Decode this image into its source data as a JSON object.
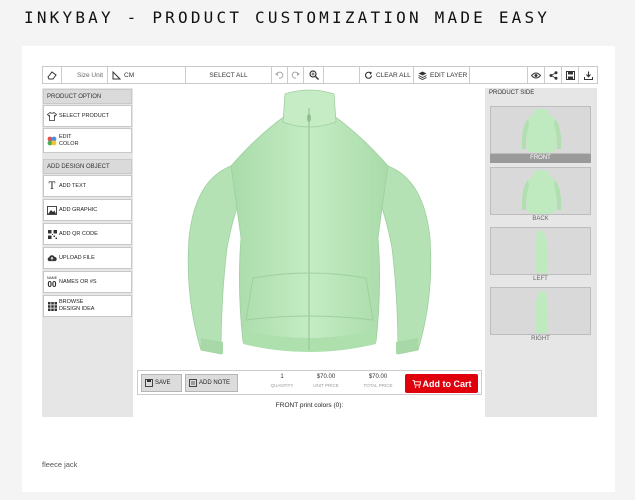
{
  "header": {
    "title": "INKYBAY - PRODUCT CUSTOMIZATION MADE EASY"
  },
  "toolbar": {
    "size_unit_label": "Size Unit",
    "unit_value": "CM",
    "select_all": "SELECT ALL",
    "clear_all": "CLEAR ALL",
    "edit_layer": "EDIT LAYER"
  },
  "sidebar": {
    "product_option_title": "PRODUCT OPTION",
    "select_product": "SELECT PRODUCT",
    "edit_color_1": "EDIT",
    "edit_color_2": "COLOR",
    "design_title": "ADD DESIGN OBJECT",
    "add_text": "ADD TEXT",
    "add_graphic": "ADD GRAPHIC",
    "add_qr": "ADD QR CODE",
    "upload_file": "UPLOAD FILE",
    "names_numbers": "NAMES OR #S",
    "browse_1": "BROWSE",
    "browse_2": "DESIGN IDEA"
  },
  "product_side": {
    "title": "PRODUCT SIDE",
    "sides": [
      "FRONT",
      "BACK",
      "LEFT",
      "RIGHT"
    ],
    "active": "FRONT"
  },
  "bottom": {
    "save": "SAVE",
    "add_note": "ADD NOTE",
    "quantity_value": "1",
    "quantity_label": "QUANTITY",
    "unit_price_value": "$70.00",
    "unit_price_label": "UNIT PRICE",
    "total_price_value": "$70.00",
    "total_price_label": "TOTAL PRICE",
    "add_to_cart": "Add to Cart"
  },
  "print_colors": "FRONT print colors  (0):",
  "caption": "fleece jack",
  "colors": {
    "jacket": "#bfe9bf",
    "cart": "#e0000b"
  }
}
